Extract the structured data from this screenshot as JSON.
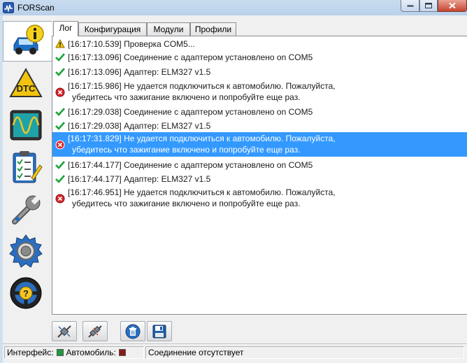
{
  "window": {
    "title": "FORScan"
  },
  "tabs": [
    {
      "label": "Лог",
      "active": true
    },
    {
      "label": "Конфигурация",
      "active": false
    },
    {
      "label": "Модули",
      "active": false
    },
    {
      "label": "Профили",
      "active": false
    }
  ],
  "sidebar": {
    "items": [
      {
        "name": "vehicle-info",
        "icon": "car-info-icon",
        "active": true
      },
      {
        "name": "dtc",
        "icon": "dtc-warning-icon",
        "label": "DTC"
      },
      {
        "name": "oscilloscope",
        "icon": "oscilloscope-icon"
      },
      {
        "name": "tests",
        "icon": "checklist-icon"
      },
      {
        "name": "service",
        "icon": "wrench-icon"
      },
      {
        "name": "settings",
        "icon": "gear-icon"
      },
      {
        "name": "help",
        "icon": "help-steering-icon",
        "label": "?"
      }
    ]
  },
  "log": {
    "entries": [
      {
        "type": "warning",
        "text": "[16:17:10.539] Проверка COM5..."
      },
      {
        "type": "ok",
        "text": "[16:17:13.096] Соединение с адаптером установлено on COM5"
      },
      {
        "type": "ok",
        "text": "[16:17:13.096] Адаптер:  ELM327 v1.5"
      },
      {
        "type": "error",
        "text": "[16:17:15.986] Не удается подключиться к автомобилю. Пожалуйста,",
        "text2": "убедитесь что зажигание включено и попробуйте еще раз."
      },
      {
        "type": "ok",
        "text": "[16:17:29.038] Соединение с адаптером установлено on COM5"
      },
      {
        "type": "ok",
        "text": "[16:17:29.038] Адаптер:  ELM327 v1.5"
      },
      {
        "type": "error",
        "selected": true,
        "text": "[16:17:31.829] Не удается подключиться к автомобилю. Пожалуйста,",
        "text2": "убедитесь что зажигание включено и попробуйте еще раз."
      },
      {
        "type": "ok",
        "text": "[16:17:44.177] Соединение с адаптером установлено on COM5"
      },
      {
        "type": "ok",
        "text": "[16:17:44.177] Адаптер:  ELM327 v1.5"
      },
      {
        "type": "error",
        "text": "[16:17:46.951] Не удается подключиться к автомобилю. Пожалуйста,",
        "text2": "убедитесь что зажигание включено и попробуйте еще раз."
      }
    ]
  },
  "toolbar": {
    "buttons": [
      {
        "name": "connect-button",
        "icon": "plug-connect-icon"
      },
      {
        "name": "disconnect-button",
        "icon": "plug-disconnect-icon"
      },
      {
        "name": "clear-log-button",
        "icon": "trash-icon"
      },
      {
        "name": "save-log-button",
        "icon": "save-icon"
      }
    ]
  },
  "status": {
    "interface_label": "Интерфейс:",
    "interface_color": "#1f9a3c",
    "vehicle_label": "Автомобиль:",
    "vehicle_color": "#8b1a1a",
    "connection_text": "Соединение отсутствует"
  }
}
